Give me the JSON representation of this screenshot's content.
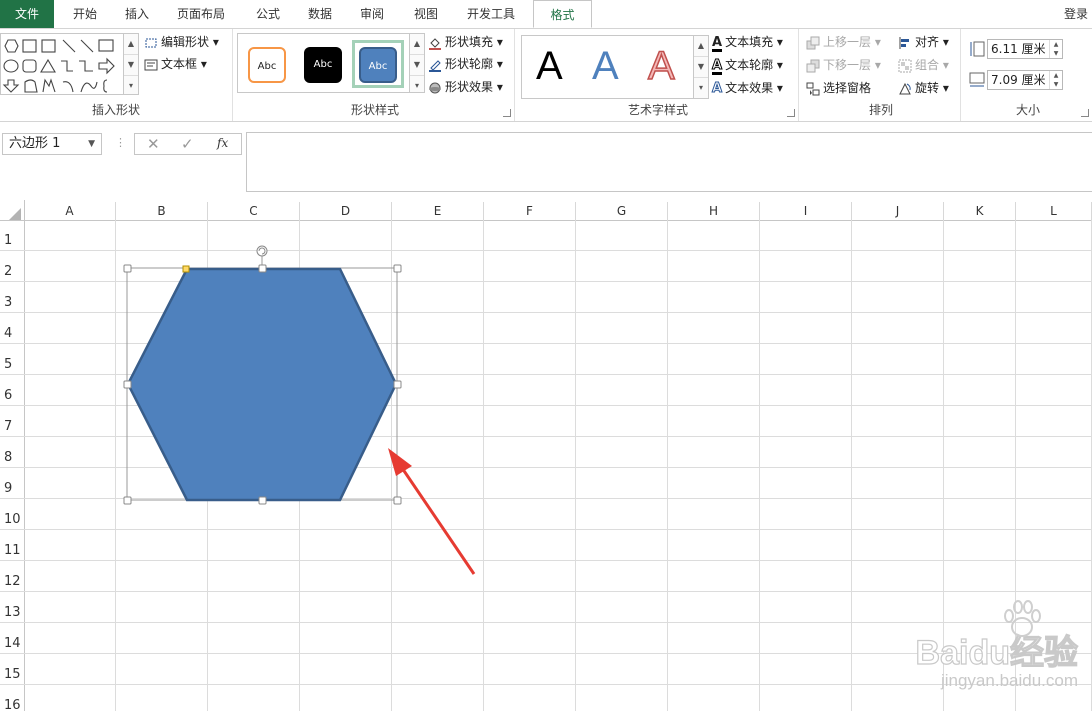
{
  "tabs": [
    {
      "label": "文件",
      "active": false
    },
    {
      "label": "开始",
      "active": false
    },
    {
      "label": "插入",
      "active": false
    },
    {
      "label": "页面布局",
      "active": false
    },
    {
      "label": "公式",
      "active": false
    },
    {
      "label": "数据",
      "active": false
    },
    {
      "label": "审阅",
      "active": false
    },
    {
      "label": "视图",
      "active": false
    },
    {
      "label": "开发工具",
      "active": false
    },
    {
      "label": "格式",
      "active": true
    }
  ],
  "login": "登录",
  "ribbon": {
    "insert_shapes": {
      "label": "插入形状",
      "edit_shape": "编辑形状",
      "text_box": "文本框"
    },
    "shape_styles": {
      "label": "形状样式",
      "swatch_text": "Abc",
      "fill": "形状填充",
      "outline": "形状轮廓",
      "effects": "形状效果"
    },
    "wordart_styles": {
      "label": "艺术字样式",
      "glyph": "A",
      "text_fill": "文本填充",
      "text_outline": "文本轮廓",
      "text_effects": "文本效果"
    },
    "arrange": {
      "label": "排列",
      "bring_forward": "上移一层",
      "send_backward": "下移一层",
      "selection_pane": "选择窗格",
      "align": "对齐",
      "group": "组合",
      "rotate": "旋转"
    },
    "size": {
      "label": "大小",
      "height": "6.11 厘米",
      "width": "7.09 厘米"
    }
  },
  "formula_bar": {
    "name_box": "六边形 1",
    "fx": "fx",
    "value": ""
  },
  "columns": [
    "A",
    "B",
    "C",
    "D",
    "E",
    "F",
    "G",
    "H",
    "I",
    "J",
    "K",
    "L"
  ],
  "rows": [
    "1",
    "2",
    "3",
    "4",
    "5",
    "6",
    "7",
    "8",
    "9",
    "10",
    "11",
    "12",
    "13",
    "14",
    "15",
    "16"
  ],
  "shape": {
    "type": "hexagon",
    "fill": "#4f81bd",
    "stroke": "#385d8a"
  },
  "annotation_arrow_color": "#e63b32",
  "colors": {
    "file_tab": "#217346",
    "active_tab_text": "#217346"
  },
  "watermark": {
    "brand": "Baidu经验",
    "url": "jingyan.baidu.com"
  }
}
